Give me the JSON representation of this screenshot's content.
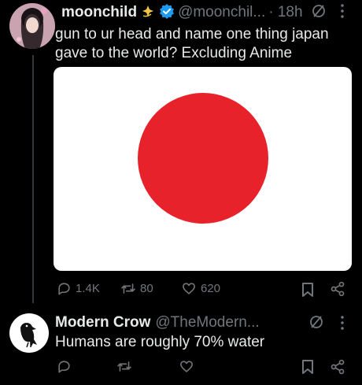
{
  "post": {
    "author": {
      "name": "moonchild",
      "handle": "@moonchil...",
      "time": "· 18h",
      "verified": true
    },
    "text": "gun to ur head and name one thing japan gave to the world? Excluding Anime",
    "image": {
      "background": "#ffffff",
      "circle_color": "#e8222a"
    },
    "actions": {
      "replies": "1.4K",
      "reposts": "80",
      "likes": "620"
    }
  },
  "reply": {
    "author": {
      "name": "Modern Crow",
      "handle": "@TheModern..."
    },
    "text": "Humans are roughly 70% water",
    "actions": {
      "replies": "",
      "reposts": "",
      "likes": ""
    }
  },
  "colors": {
    "verified_badge": "#1d9bf0",
    "muted_text": "#71767b",
    "text": "#e7e9ea",
    "background": "#000000"
  },
  "icons": [
    "sparkles-icon",
    "verified-badge-icon",
    "grok-icon",
    "more-icon",
    "reply-icon",
    "repost-icon",
    "like-icon",
    "bookmark-icon",
    "share-icon"
  ]
}
